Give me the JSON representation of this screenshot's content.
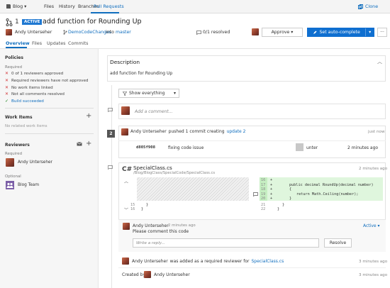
{
  "nav": {
    "project": "Blog",
    "items": [
      "Files",
      "History",
      "Branches",
      "Pull Requests"
    ],
    "clone": "Clone"
  },
  "pr": {
    "id": "1",
    "status": "ACTIVE",
    "title": "add function for Rounding Up",
    "author": "Andy Unterseher",
    "source_branch": "DemoCodeChanges",
    "into": "into",
    "target_branch": "master",
    "resolved": "0/1 resolved",
    "approve": "Approve",
    "auto_complete": "Set auto-complete",
    "more": "···"
  },
  "tabs": [
    "Overview",
    "Files",
    "Updates",
    "Commits"
  ],
  "sidebar": {
    "policies_title": "Policies",
    "required_label": "Required",
    "policies": [
      {
        "text": "0 of 1 reviewers approved",
        "status": "fail"
      },
      {
        "text": "Required reviewers have not approved",
        "status": "fail"
      },
      {
        "text": "No work items linked",
        "status": "fail"
      },
      {
        "text": "Not all comments resolved",
        "status": "fail"
      },
      {
        "text": "Build succeeded",
        "status": "pass"
      }
    ],
    "work_items_title": "Work Items",
    "work_items_empty": "No related work items",
    "reviewers_title": "Reviewers",
    "reviewers_required": "Required",
    "reviewer_required": "Andy Unterseher",
    "reviewers_optional": "Optional",
    "reviewer_optional": "Blog Team"
  },
  "description": {
    "title": "Description",
    "body": "add function for Rounding Up"
  },
  "filter": {
    "label": "Show everything"
  },
  "comment_box": {
    "placeholder": "Add a comment..."
  },
  "push": {
    "badge": "2",
    "author": "Andy Unterseher",
    "text": "pushed 1 commit creating",
    "link": "update 2",
    "time": "just now",
    "commit_id": "d805f908",
    "commit_msg": "fixing code issue",
    "committer": "unter",
    "commit_time": "2 minutes ago"
  },
  "file_thread": {
    "lang_icon": "C#",
    "file": "SpecialClass.cs",
    "path": "/Blog/BlogClass/SpecialCode/SpecialClass.cs",
    "time": "2 minutes ago",
    "left_lines": [
      {
        "n": "15",
        "code": "}"
      },
      {
        "n": "16",
        "code": "}"
      }
    ],
    "right_lines": [
      {
        "n": "16",
        "mark": "+",
        "code": ""
      },
      {
        "n": "17",
        "mark": "+",
        "code": "public decimal RoundUp(decimal number)"
      },
      {
        "n": "18",
        "mark": "+",
        "code": "{"
      },
      {
        "n": "19",
        "mark": "+",
        "code": "return Math.Ceiling(number);"
      },
      {
        "n": "20",
        "mark": "+",
        "code": "}"
      },
      {
        "n": "21",
        "mark": "",
        "code": "}"
      },
      {
        "n": "22",
        "mark": "",
        "code": "}"
      }
    ],
    "comment_author": "Andy Unterseher",
    "comment_time": "2 minutes ago",
    "comment_text": "Please comment this code",
    "status": "Active",
    "reply_placeholder": "Write a reply...",
    "resolve": "Resolve"
  },
  "events": [
    {
      "author": "Andy Unterseher",
      "text": "was added as a required reviewer for",
      "link": "SpecialClass.cs",
      "time": "3 minutes ago"
    },
    {
      "prefix": "Created by",
      "author": "Andy Unterseher",
      "time": "3 minutes ago"
    }
  ]
}
